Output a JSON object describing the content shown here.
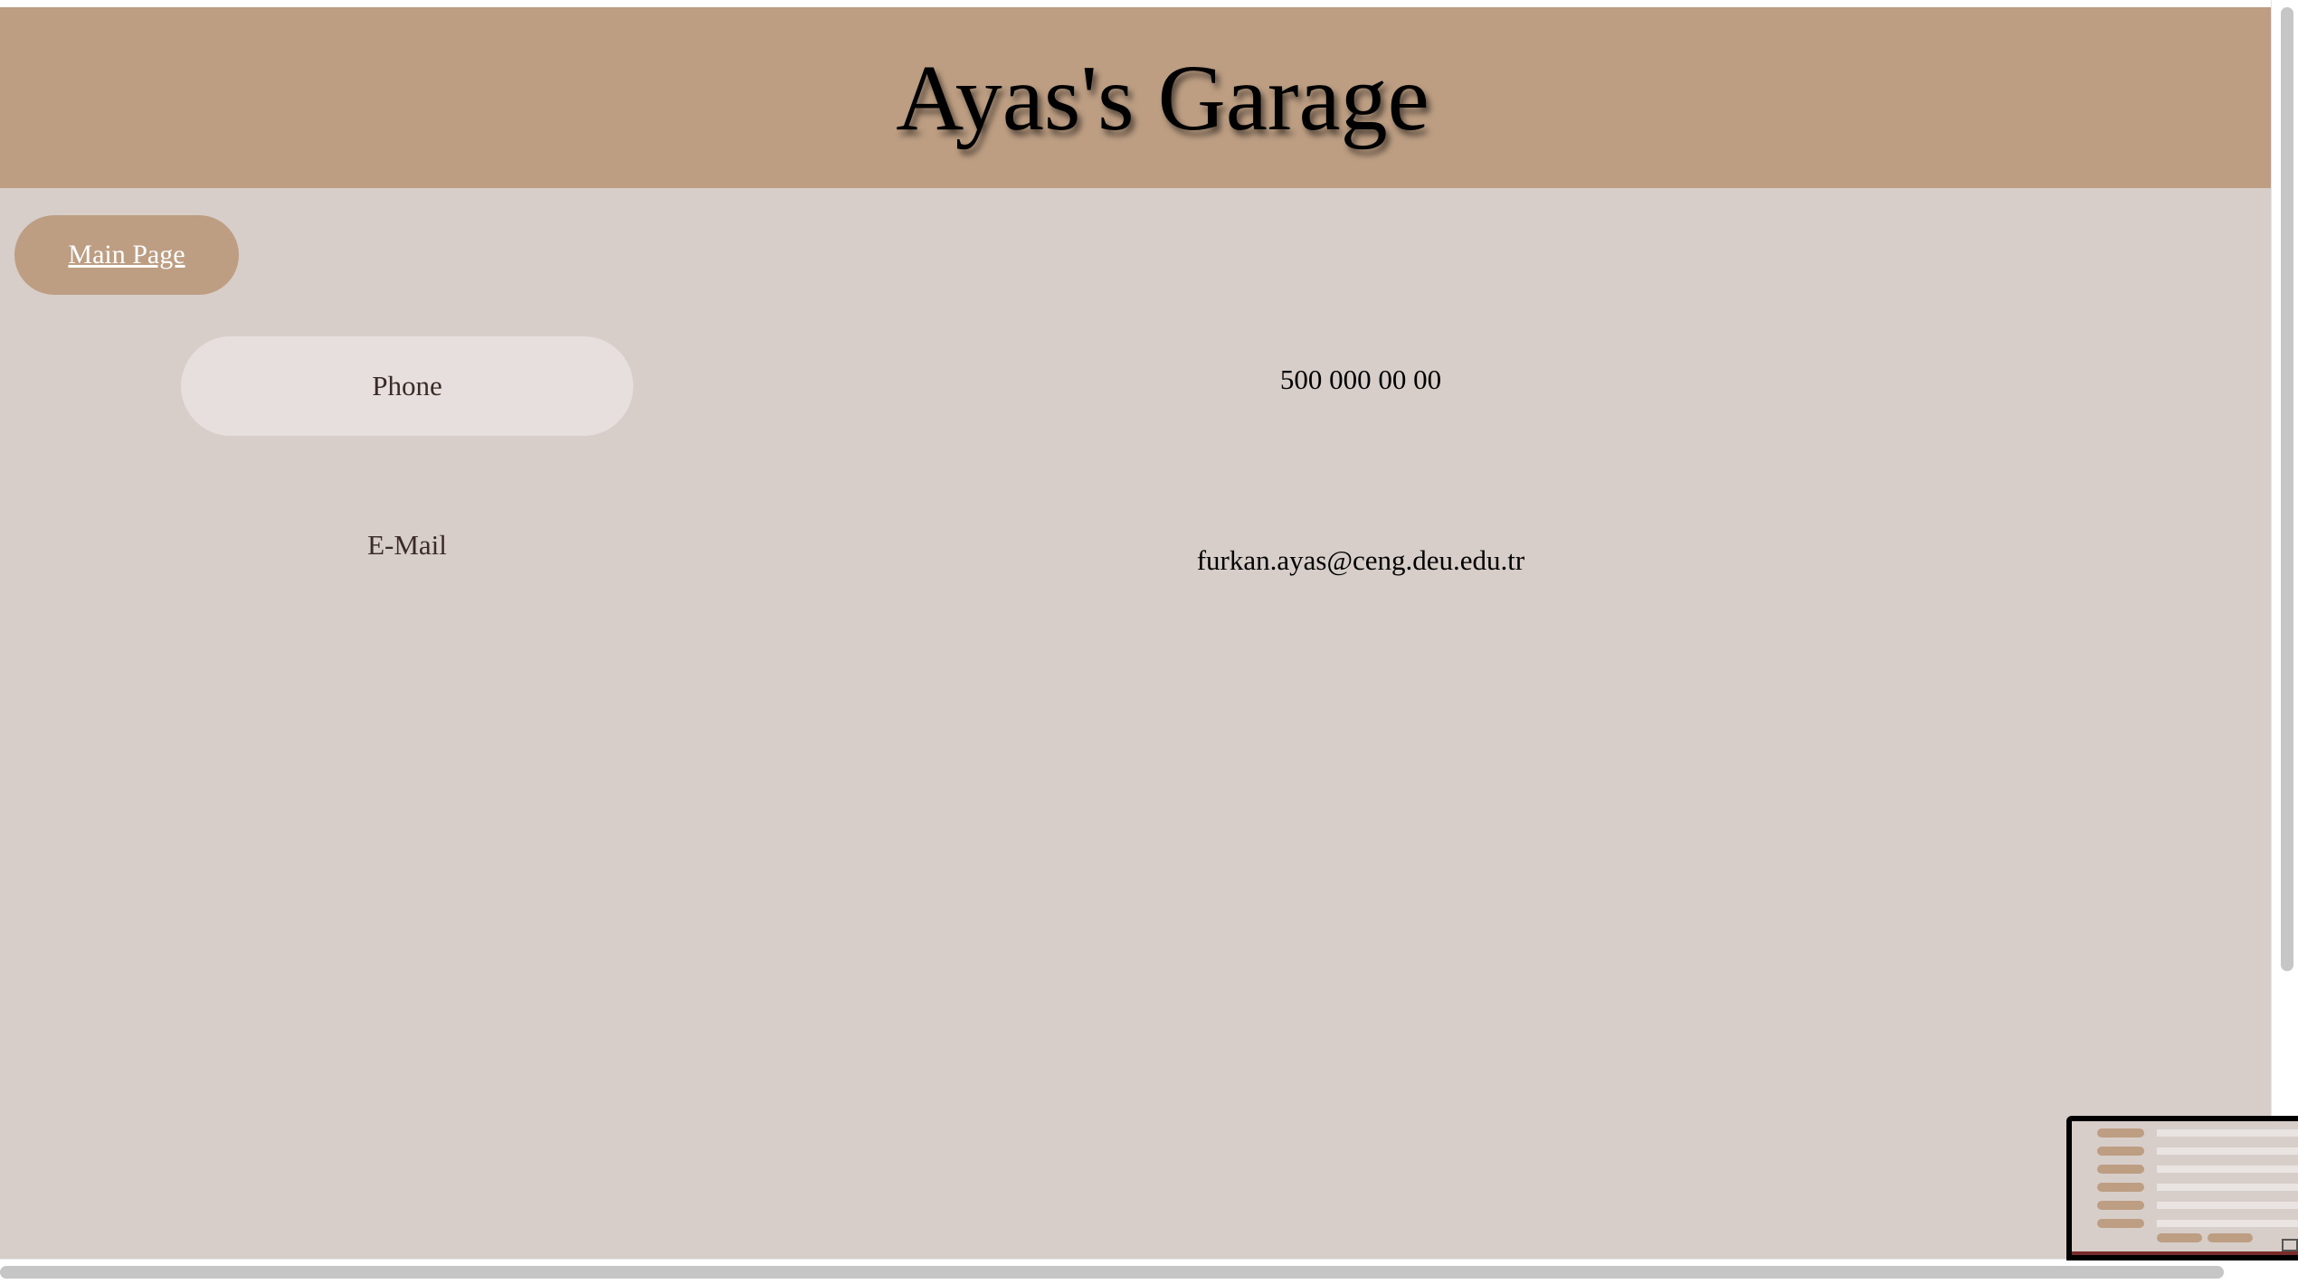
{
  "header": {
    "title": "Ayas's Garage"
  },
  "nav": {
    "main_page_label": "Main Page"
  },
  "contact": {
    "rows": [
      {
        "label": "Phone",
        "value": "500 000 00 00"
      },
      {
        "label": "E-Mail",
        "value": "furkan.ayas@ceng.deu.edu.tr"
      }
    ]
  },
  "colors": {
    "banner": "#bd9e83",
    "page_background": "#d7cec9",
    "label_pill": "#e7dfdd",
    "button_text": "#ffffff"
  }
}
